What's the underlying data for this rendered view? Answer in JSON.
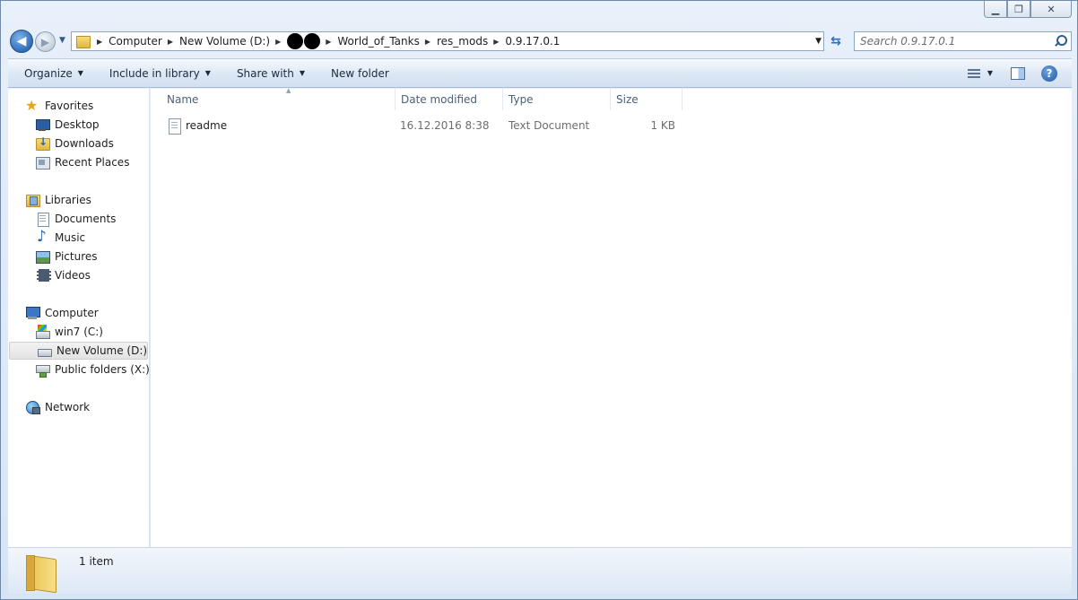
{
  "address": {
    "crumbs": [
      "Computer",
      "New Volume (D:)",
      "World_of_Tanks",
      "res_mods",
      "0.9.17.0.1"
    ]
  },
  "search": {
    "placeholder": "Search 0.9.17.0.1"
  },
  "toolbar": {
    "organize": "Organize",
    "include_library": "Include in library",
    "share_with": "Share with",
    "new_folder": "New folder"
  },
  "nav": {
    "favorites": {
      "label": "Favorites",
      "items": [
        "Desktop",
        "Downloads",
        "Recent Places"
      ]
    },
    "libraries": {
      "label": "Libraries",
      "items": [
        "Documents",
        "Music",
        "Pictures",
        "Videos"
      ]
    },
    "computer": {
      "label": "Computer",
      "items": [
        "win7 (C:)",
        "New Volume (D:)",
        "Public folders (X:)"
      ],
      "selected": "New Volume (D:)"
    },
    "network": {
      "label": "Network"
    }
  },
  "columns": {
    "name": "Name",
    "date": "Date modified",
    "type": "Type",
    "size": "Size"
  },
  "files": [
    {
      "name": "readme",
      "date": "16.12.2016 8:38",
      "type": "Text Document",
      "size": "1 KB"
    }
  ],
  "status": {
    "count": "1 item"
  }
}
